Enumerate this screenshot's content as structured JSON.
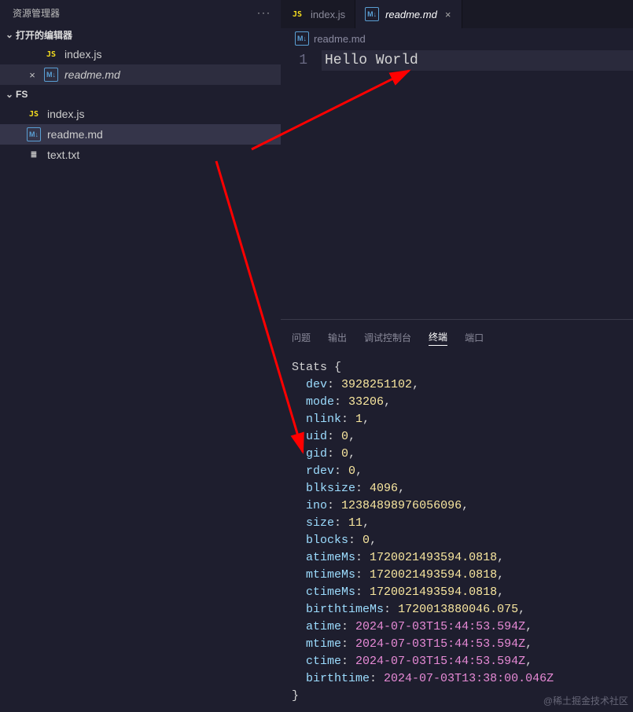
{
  "sidebar": {
    "title": "资源管理器",
    "sections": {
      "open_editors": {
        "label": "打开的编辑器"
      },
      "workspace": {
        "label": "FS"
      }
    },
    "open_items": [
      {
        "icon": "JS",
        "name": "index.js",
        "close": false
      },
      {
        "icon": "M↓",
        "name": "readme.md",
        "close": true,
        "italic": true
      }
    ],
    "fs_items": [
      {
        "icon": "JS",
        "name": "index.js"
      },
      {
        "icon": "M↓",
        "name": "readme.md",
        "selected": true
      },
      {
        "icon": "≣",
        "name": "text.txt"
      }
    ]
  },
  "tabs": [
    {
      "icon": "JS",
      "label": "index.js",
      "active": false
    },
    {
      "icon": "M↓",
      "label": "readme.md",
      "active": true,
      "italic": true,
      "closeable": true
    }
  ],
  "breadcrumb": {
    "icon": "M↓",
    "text": "readme.md"
  },
  "editor": {
    "lines": [
      {
        "num": "1",
        "text": "Hello World"
      }
    ]
  },
  "panel": {
    "tabs": [
      "问题",
      "输出",
      "调试控制台",
      "终端",
      "端口"
    ],
    "active_tab": 3,
    "stats_label": "Stats {",
    "entries": [
      {
        "key": "dev",
        "val": "3928251102",
        "type": "num"
      },
      {
        "key": "mode",
        "val": "33206",
        "type": "num"
      },
      {
        "key": "nlink",
        "val": "1",
        "type": "num"
      },
      {
        "key": "uid",
        "val": "0",
        "type": "num"
      },
      {
        "key": "gid",
        "val": "0",
        "type": "num"
      },
      {
        "key": "rdev",
        "val": "0",
        "type": "num"
      },
      {
        "key": "blksize",
        "val": "4096",
        "type": "num"
      },
      {
        "key": "ino",
        "val": "12384898976056096",
        "type": "num"
      },
      {
        "key": "size",
        "val": "11",
        "type": "num"
      },
      {
        "key": "blocks",
        "val": "0",
        "type": "num"
      },
      {
        "key": "atimeMs",
        "val": "1720021493594.0818",
        "type": "num"
      },
      {
        "key": "mtimeMs",
        "val": "1720021493594.0818",
        "type": "num"
      },
      {
        "key": "ctimeMs",
        "val": "1720021493594.0818",
        "type": "num"
      },
      {
        "key": "birthtimeMs",
        "val": "1720013880046.075",
        "type": "num"
      },
      {
        "key": "atime",
        "val": "2024-07-03T15:44:53.594Z",
        "type": "str"
      },
      {
        "key": "mtime",
        "val": "2024-07-03T15:44:53.594Z",
        "type": "str"
      },
      {
        "key": "ctime",
        "val": "2024-07-03T15:44:53.594Z",
        "type": "str"
      },
      {
        "key": "birthtime",
        "val": "2024-07-03T13:38:00.046Z",
        "type": "str"
      }
    ],
    "close_brace": "}"
  },
  "watermark": "@稀土掘金技术社区"
}
